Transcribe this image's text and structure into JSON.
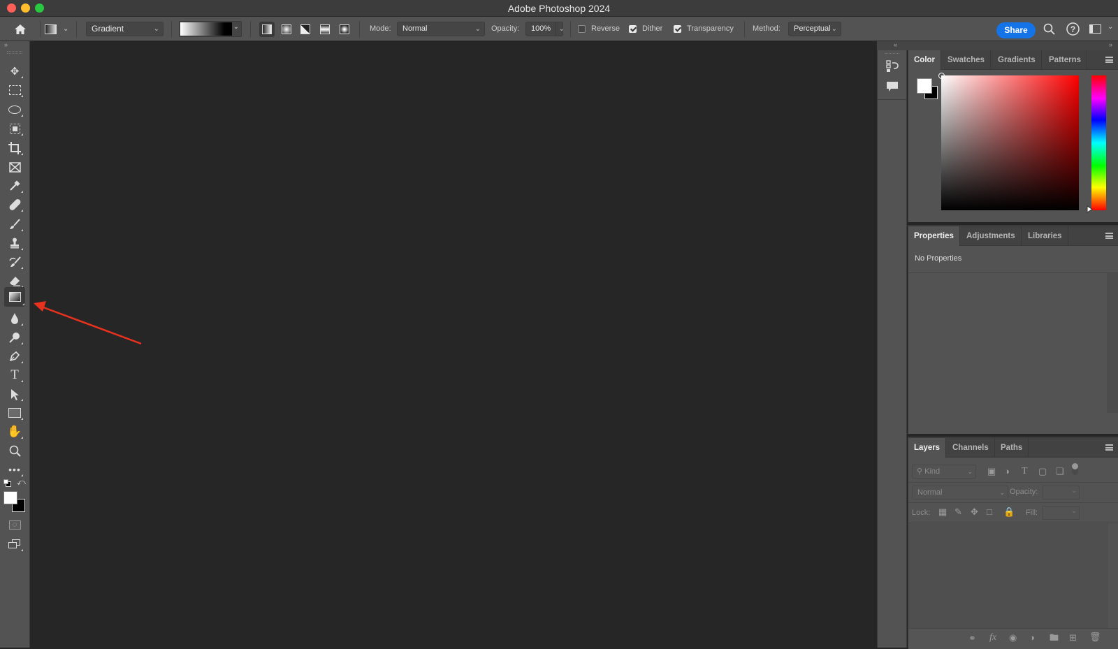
{
  "app": {
    "title": "Adobe Photoshop 2024"
  },
  "window_controls": {
    "close_color": "#fe5f57",
    "minimize_color": "#febc2e",
    "maximize_color": "#28c840"
  },
  "options_bar": {
    "home_icon": "home-icon",
    "tool_preset_icon": "gradient-tool-preset-icon",
    "gradient_type": "Gradient",
    "gradient_preview": {
      "from": "#ffffff",
      "to": "#000000"
    },
    "gradient_styles": [
      "linear",
      "radial",
      "angle",
      "reflected",
      "diamond"
    ],
    "selected_style": "linear",
    "mode_label": "Mode:",
    "mode_value": "Normal",
    "opacity_label": "Opacity:",
    "opacity_value": "100%",
    "reverse": {
      "label": "Reverse",
      "checked": false
    },
    "dither": {
      "label": "Dither",
      "checked": true
    },
    "transparency": {
      "label": "Transparency",
      "checked": true
    },
    "method_label": "Method:",
    "method_value": "Perceptual",
    "share_label": "Share",
    "accent_color": "#1473e6"
  },
  "toolbar": {
    "tools": [
      "move",
      "rectangular-marquee",
      "lasso",
      "object-selection",
      "crop",
      "frame",
      "eyedropper",
      "spot-healing-brush",
      "brush",
      "clone-stamp",
      "history-brush",
      "eraser",
      "gradient",
      "blur",
      "dodge",
      "pen",
      "type",
      "path-selection",
      "rectangle",
      "hand",
      "zoom",
      "edit-toolbar"
    ],
    "selected_tool": "gradient",
    "foreground_color": "#ffffff",
    "background_color": "#000000"
  },
  "annotation": {
    "type": "arrow",
    "color": "#e8321e",
    "points_to": "gradient-tool"
  },
  "color_panel": {
    "tabs": [
      "Color",
      "Swatches",
      "Gradients",
      "Patterns"
    ],
    "active_tab": "Color",
    "hue": "#ff0000"
  },
  "properties_panel": {
    "tabs": [
      "Properties",
      "Adjustments",
      "Libraries"
    ],
    "active_tab": "Properties",
    "message": "No Properties"
  },
  "layers_panel": {
    "tabs": [
      "Layers",
      "Channels",
      "Paths"
    ],
    "active_tab": "Layers",
    "filter_placeholder": "Kind",
    "blend_mode": "Normal",
    "opacity_label": "Opacity:",
    "lock_label": "Lock:",
    "fill_label": "Fill:",
    "footer_icons": [
      "link-icon",
      "fx-icon",
      "mask-icon",
      "adjustment-icon",
      "group-folder-icon",
      "new-layer-icon",
      "trash-icon"
    ]
  }
}
